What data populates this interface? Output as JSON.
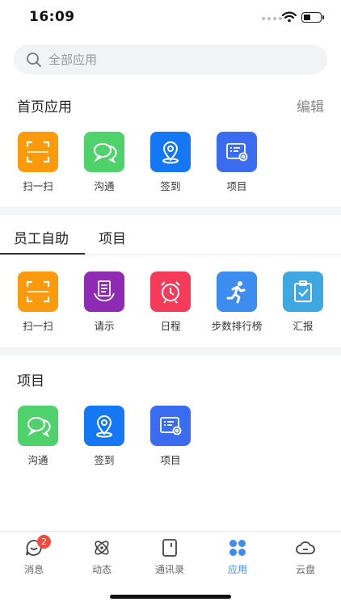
{
  "status_bar": {
    "time": "16:09"
  },
  "search": {
    "placeholder": "全部应用"
  },
  "home_apps": {
    "title": "首页应用",
    "edit_label": "编辑",
    "items": [
      {
        "label": "扫一扫",
        "icon": "scan-icon",
        "color": "#fb9a0d"
      },
      {
        "label": "沟通",
        "icon": "chat-icon",
        "color": "#4fd26c"
      },
      {
        "label": "签到",
        "icon": "location-pin-icon",
        "color": "#1677f5"
      },
      {
        "label": "项目",
        "icon": "project-settings-icon",
        "color": "#3b6cf0"
      }
    ]
  },
  "tabs": [
    {
      "label": "员工自助",
      "active": true
    },
    {
      "label": "项目",
      "active": false
    }
  ],
  "self_service_apps": {
    "items": [
      {
        "label": "扫一扫",
        "icon": "scan-icon",
        "color": "#fb9a0d"
      },
      {
        "label": "请示",
        "icon": "request-document-icon",
        "color": "#8e2ab4"
      },
      {
        "label": "日程",
        "icon": "alarm-clock-icon",
        "color": "#f53a5a"
      },
      {
        "label": "步数排行榜",
        "icon": "running-man-icon",
        "color": "#3d8cf0"
      },
      {
        "label": "汇报",
        "icon": "clipboard-check-icon",
        "color": "#3fa7e2"
      }
    ]
  },
  "project_apps": {
    "title": "项目",
    "items": [
      {
        "label": "沟通",
        "icon": "chat-icon",
        "color": "#4fd26c"
      },
      {
        "label": "签到",
        "icon": "location-pin-icon",
        "color": "#1677f5"
      },
      {
        "label": "项目",
        "icon": "project-settings-icon",
        "color": "#3b6cf0"
      }
    ]
  },
  "bottom_nav": {
    "active_color": "#3d8cf0",
    "items": [
      {
        "label": "消息",
        "icon": "message-icon",
        "badge": "2"
      },
      {
        "label": "动态",
        "icon": "atom-icon"
      },
      {
        "label": "通讯录",
        "icon": "contacts-book-icon"
      },
      {
        "label": "应用",
        "icon": "apps-grid-icon",
        "active": true
      },
      {
        "label": "云盘",
        "icon": "cloud-icon"
      }
    ]
  }
}
